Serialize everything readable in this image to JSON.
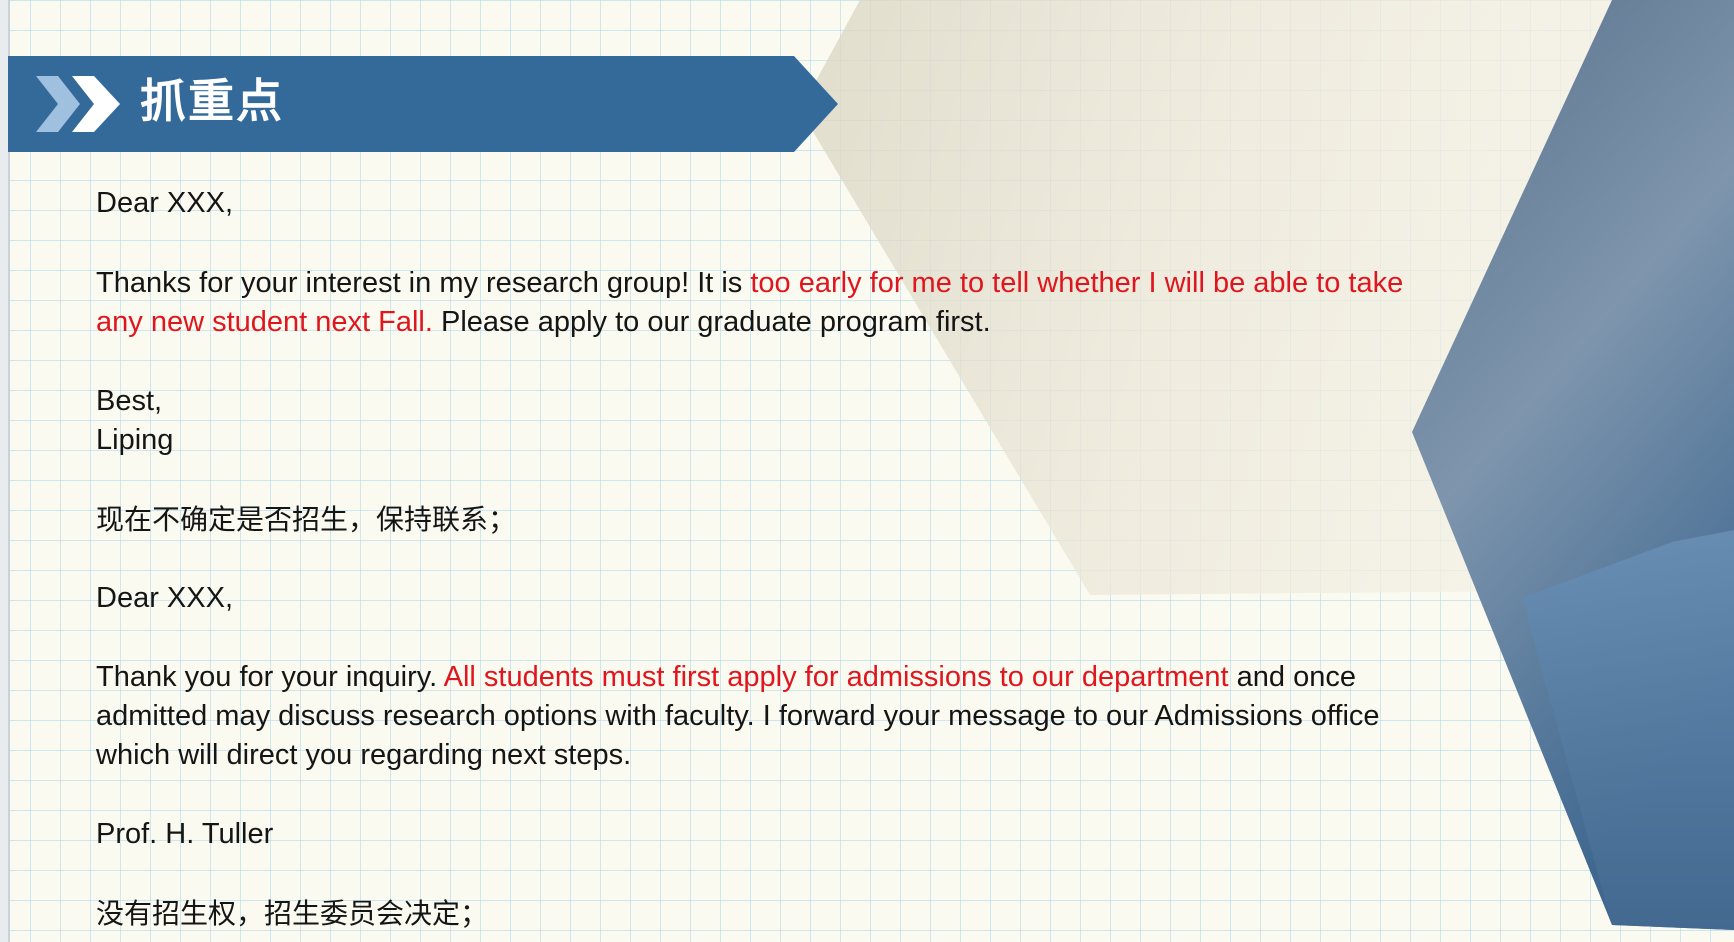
{
  "slide": {
    "title": "抓重点",
    "colors": {
      "banner": "#336a9a",
      "highlight": "#e0161e",
      "text": "#151515",
      "background": "#fbfaf1"
    },
    "icons": [
      "double-chevron-right-icon"
    ]
  },
  "email1": {
    "greeting": "Dear XXX,",
    "body_line1_plain": "Thanks for your interest in my research group! It is ",
    "body_line1_red": "too early for me to tell whether I will be able to take",
    "body_line2_red": "any new student next Fall.",
    "body_line2_plain": " Please apply to our graduate program first.",
    "closing": "Best,",
    "signature": "Liping",
    "note": "现在不确定是否招生，保持联系；"
  },
  "email2": {
    "greeting": "Dear  XXX,",
    "body_line1_plain_a": "Thank you for your inquiry.  ",
    "body_line1_red": "All students must first apply for admissions to our department",
    "body_line1_plain_b": " and once",
    "body_line2": "admitted may discuss research options with faculty.  I forward your message to our Admissions office",
    "body_line3": "which will direct you regarding next steps.",
    "signature": "Prof. H. Tuller",
    "note": "没有招生权，招生委员会决定；"
  }
}
